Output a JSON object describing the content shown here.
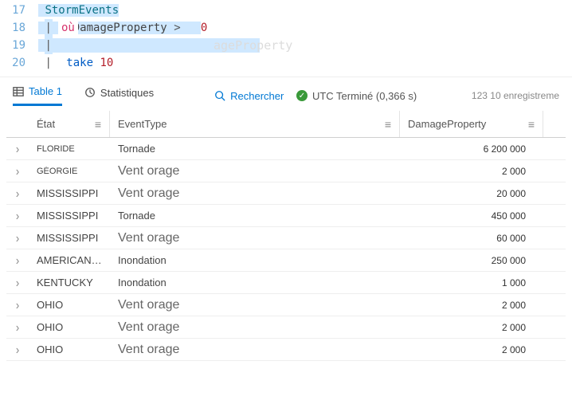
{
  "editor": {
    "lines": [
      "17",
      "18",
      "19",
      "20"
    ],
    "code_line1": "StormEvents",
    "code_line2_where": "où",
    "code_line2_prop": "DamageProperty",
    "code_line2_op": ">",
    "code_line2_val": "0",
    "code_line3": "",
    "code_line4_take": "take",
    "code_line4_num": "10",
    "ghost_suffix": "ageProperty"
  },
  "tabs": {
    "table_label": "Table 1",
    "stats_label": "Statistiques",
    "search_label": "Rechercher",
    "status_prefix": "UTC Terminé (0,366 s)",
    "count_label": "123 10 enregistreme"
  },
  "columns": {
    "state": "État",
    "event": "EventType",
    "damage": "DamageProperty"
  },
  "rows": [
    {
      "state": "FLORIDE",
      "state_small": true,
      "event": "Tornade",
      "event_big": false,
      "damage": "6 200 000"
    },
    {
      "state": "GÉORGIE",
      "state_small": true,
      "event": "Vent orage",
      "event_big": true,
      "damage": "2 000"
    },
    {
      "state": "MISSISSIPPI",
      "state_small": false,
      "event": "Vent orage",
      "event_big": true,
      "damage": "20 000"
    },
    {
      "state": "MISSISSIPPI",
      "state_small": false,
      "event": "Tornade",
      "event_big": false,
      "damage": "450 000"
    },
    {
      "state": "MISSISSIPPI",
      "state_small": false,
      "event": "Vent orage",
      "event_big": true,
      "damage": "60 000"
    },
    {
      "state": "AMERICAN…",
      "state_small": false,
      "event": "Inondation",
      "event_big": false,
      "damage": "250 000"
    },
    {
      "state": "KENTUCKY",
      "state_small": false,
      "event": "Inondation",
      "event_big": false,
      "damage": "1 000"
    },
    {
      "state": "OHIO",
      "state_small": false,
      "event": "Vent orage",
      "event_big": true,
      "damage": "2 000"
    },
    {
      "state": "OHIO",
      "state_small": false,
      "event": "Vent orage",
      "event_big": true,
      "damage": "2 000"
    },
    {
      "state": "OHIO",
      "state_small": false,
      "event": "Vent orage",
      "event_big": true,
      "damage": "2 000"
    }
  ]
}
